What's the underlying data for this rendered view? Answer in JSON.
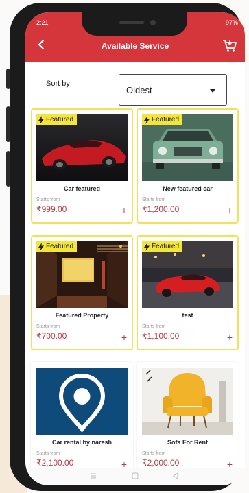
{
  "status_bar": {
    "time": "2:21",
    "indicators": "97%"
  },
  "header": {
    "title": "Available Service",
    "back_icon": "back-arrow-icon",
    "cart_icon": "cart-icon"
  },
  "sort": {
    "label": "Sort by",
    "selected": "Oldest"
  },
  "badge_label": "Featured",
  "starts_from_label": "Starts from",
  "colors": {
    "header": "#d5363b",
    "badge": "#f4e53a",
    "card_border": "#f2e25a",
    "price": "#b83a3f"
  },
  "products": [
    {
      "name": "Car featured",
      "price": "₹999.00",
      "featured": true
    },
    {
      "name": "New featured car",
      "price": "₹1,200.00",
      "featured": true
    },
    {
      "name": "Featured Property",
      "price": "₹700.00",
      "featured": true
    },
    {
      "name": "test",
      "price": "₹1,100.00",
      "featured": true
    },
    {
      "name": "Car rental by naresh",
      "price": "₹2,100.00",
      "featured": false
    },
    {
      "name": "Sofa For Rent",
      "price": "₹2,000.00",
      "featured": false
    }
  ],
  "nav_bar": {
    "icons": [
      "menu-icon",
      "home-icon",
      "back-icon"
    ]
  }
}
